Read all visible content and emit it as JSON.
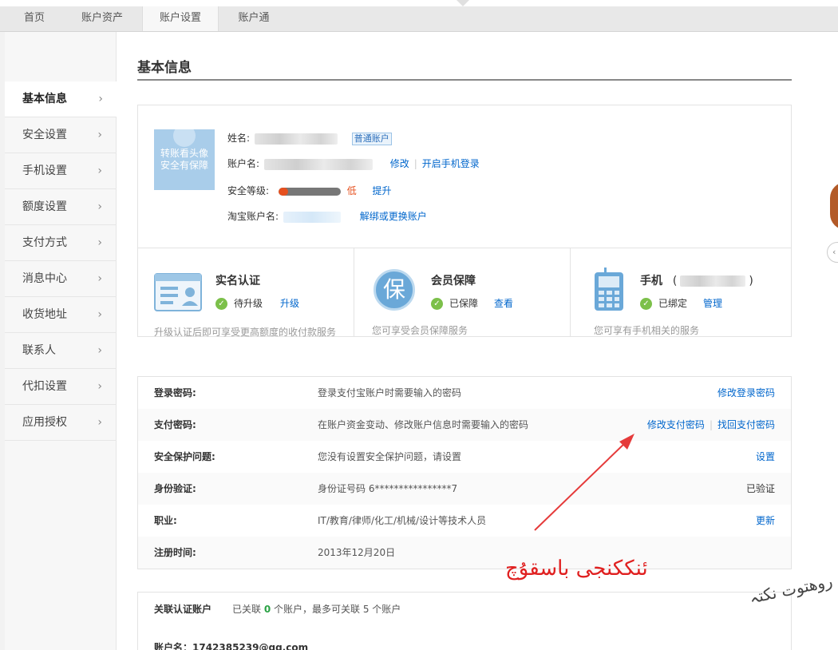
{
  "topnav": {
    "tabs": [
      {
        "label": "首页"
      },
      {
        "label": "账户资产"
      },
      {
        "label": "账户设置"
      },
      {
        "label": "账户通"
      }
    ]
  },
  "sidebar": {
    "items": [
      {
        "label": "基本信息"
      },
      {
        "label": "安全设置"
      },
      {
        "label": "手机设置"
      },
      {
        "label": "额度设置"
      },
      {
        "label": "支付方式"
      },
      {
        "label": "消息中心"
      },
      {
        "label": "收货地址"
      },
      {
        "label": "联系人"
      },
      {
        "label": "代扣设置"
      },
      {
        "label": "应用授权"
      }
    ],
    "chevron": "›"
  },
  "page": {
    "title": "基本信息"
  },
  "profile": {
    "avatar_text_1": "转账看头像",
    "avatar_text_2": "安全有保障",
    "name_label": "姓名:",
    "account_type": "普通账户",
    "account_label": "账户名:",
    "modify": "修改",
    "enable_phone_login": "开启手机登录",
    "security_label": "安全等级:",
    "security_level": "低",
    "security_level_fraction": 0.15,
    "upgrade": "提升",
    "taobao_label": "淘宝账户名:",
    "unbind": "解绑或更换账户"
  },
  "features": [
    {
      "title": "实名认证",
      "status": "待升级",
      "action": "升级",
      "desc": "升级认证后即可享受更高额度的收付款服务",
      "icon": "id-card-icon"
    },
    {
      "title": "会员保障",
      "status": "已保障",
      "action": "查看",
      "desc": "您可享受会员保障服务",
      "icon": "protection-icon",
      "icon_char": "保"
    },
    {
      "title": "手机",
      "title_paren_open": "(",
      "title_paren_close": ")",
      "status": "已绑定",
      "action": "管理",
      "desc": "您可享有手机相关的服务",
      "icon": "mobile-phone-icon"
    }
  ],
  "security": {
    "rows": [
      {
        "key": "登录密码:",
        "desc": "登录支付宝账户时需要输入的密码",
        "action": "修改登录密码"
      },
      {
        "key": "支付密码:",
        "desc": "在账户资金变动、修改账户信息时需要输入的密码",
        "action": "修改支付密码",
        "action2": "找回支付密码"
      },
      {
        "key": "安全保护问题:",
        "desc": "您没有设置安全保护问题，请设置",
        "action": "设置"
      },
      {
        "key": "身份验证:",
        "desc": "身份证号码 6****************7",
        "status": "已验证"
      },
      {
        "key": "职业:",
        "desc": "IT/教育/律师/化工/机械/设计等技术人员",
        "action": "更新"
      },
      {
        "key": "注册时间:",
        "desc": "2013年12月20日"
      }
    ]
  },
  "linked": {
    "title": "关联认证账户",
    "desc_prefix": "已关联",
    "count": "0",
    "desc_suffix": "个账户，最多可关联 5 个账户",
    "account": "账户名：1742385239@qq.com"
  },
  "annotation": {
    "text": "ئنککنجی باسقۇچ",
    "color": "#e02020"
  },
  "watermark": {
    "text": "روهتوت نکتہ"
  },
  "colors": {
    "link": "#0066cc",
    "check": "#7cc04a",
    "low": "#e6501e"
  }
}
